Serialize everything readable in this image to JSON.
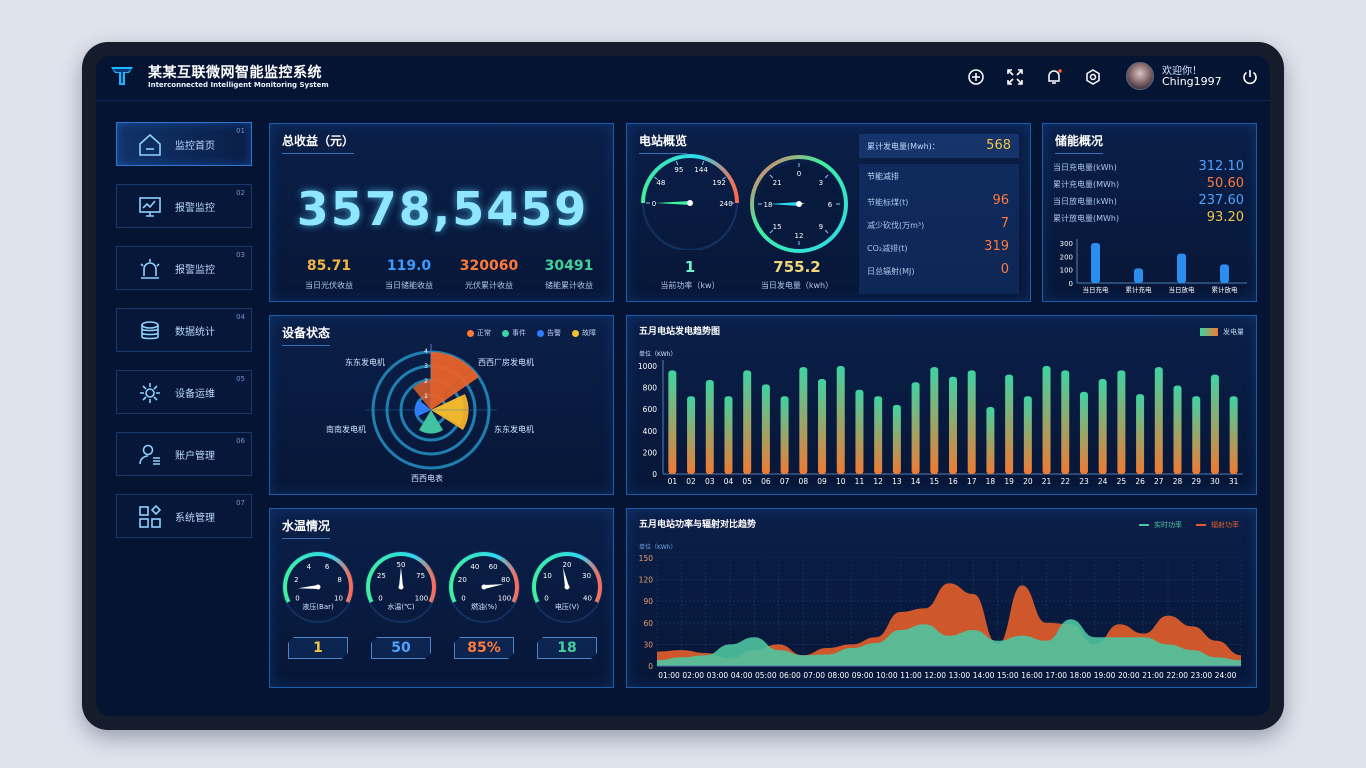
{
  "app": {
    "title": "某某互联微网智能监控系统",
    "subtitle": "Interconnected Intelligent Monitoring System",
    "welcome": "欢迎你！",
    "username": "Ching1997"
  },
  "header_icons": [
    "add-circle-icon",
    "fullscreen-icon",
    "bell-icon",
    "settings-icon",
    "power-icon"
  ],
  "nav": [
    {
      "label": "监控首页",
      "num": "01",
      "icon": "home-icon",
      "active": true
    },
    {
      "label": "报警监控",
      "num": "02",
      "icon": "monitor-chart-icon"
    },
    {
      "label": "报警监控",
      "num": "03",
      "icon": "alarm-light-icon"
    },
    {
      "label": "数据统计",
      "num": "04",
      "icon": "database-icon"
    },
    {
      "label": "设备运维",
      "num": "05",
      "icon": "gear-icon"
    },
    {
      "label": "账户管理",
      "num": "06",
      "icon": "user-icon"
    },
    {
      "label": "系统管理",
      "num": "07",
      "icon": "apps-icon"
    }
  ],
  "revenue": {
    "title": "总收益（元）",
    "total": "3578,5459",
    "stats": [
      {
        "value": "85.71",
        "label": "当日光伏收益",
        "color": "#f2b642"
      },
      {
        "value": "119.0",
        "label": "当日储能收益",
        "color": "#3d9bff"
      },
      {
        "value": "320060",
        "label": "光伏累计收益",
        "color": "#ff7a3a"
      },
      {
        "value": "30491",
        "label": "储能累计收益",
        "color": "#41d19b"
      }
    ]
  },
  "station": {
    "title": "电站概览",
    "gauge1": {
      "ticks": [
        "0",
        "48",
        "95",
        "144",
        "192",
        "240"
      ],
      "value": "1",
      "label": "当前功率（kw）",
      "reading": 1
    },
    "gauge2": {
      "ticks": [
        "0",
        "3",
        "6",
        "9",
        "12",
        "15",
        "18",
        "21"
      ],
      "value": "755.2",
      "label": "当日发电量（kwh）"
    },
    "cum_label": "累计发电量(Mwh)：",
    "cum_value": "568",
    "save_title": "节能减排",
    "items": [
      {
        "label": "节能标煤(t)",
        "value": "96"
      },
      {
        "label": "减少砍伐(万m³)",
        "value": "7"
      },
      {
        "label": "CO₂减排(t)",
        "value": "319"
      },
      {
        "label": "日总辐射(MJ)",
        "value": "0"
      }
    ]
  },
  "storage": {
    "title": "储能概况",
    "items": [
      {
        "label": "当日充电量(kWh)",
        "value": "312.10",
        "color": "#4fa3ff"
      },
      {
        "label": "累计充电量(MWh)",
        "value": "50.60",
        "color": "#ff7a3a"
      },
      {
        "label": "当日放电量(kWh)",
        "value": "237.60",
        "color": "#4fa3ff"
      },
      {
        "label": "累计放电量(MWh)",
        "value": "93.20",
        "color": "#f2c542"
      }
    ]
  },
  "storage_chart": {
    "type": "bar",
    "categories": [
      "当日充电",
      "累计充电",
      "当日放电",
      "累计放电"
    ],
    "values": [
      300,
      110,
      220,
      140
    ],
    "yticks": [
      "0",
      "100",
      "200",
      "300"
    ],
    "ylim": [
      0,
      300
    ]
  },
  "device": {
    "title": "设备状态",
    "legend": [
      {
        "name": "正常",
        "color": "#ff7a2f"
      },
      {
        "name": "事件",
        "color": "#3fd3a3"
      },
      {
        "name": "告警",
        "color": "#2f7cff"
      },
      {
        "name": "故障",
        "color": "#f2c130"
      }
    ],
    "labels": [
      "东东发电机",
      "西西厂房发电机",
      "东东发电机",
      "西西电表",
      "南南发电机"
    ],
    "rticks": [
      "1",
      "2",
      "3",
      "4"
    ]
  },
  "water": {
    "title": "水温情况",
    "gauges": [
      {
        "label": "液压(Bar)",
        "ticks": [
          "0",
          "2",
          "4",
          "6",
          "8",
          "10"
        ],
        "value": "1",
        "color": "#f2c542"
      },
      {
        "label": "水温(℃)",
        "ticks": [
          "0",
          "25",
          "50",
          "75",
          "100"
        ],
        "value": "50",
        "color": "#4fa3ff"
      },
      {
        "label": "燃油(%)",
        "ticks": [
          "0",
          "20",
          "40",
          "60",
          "80",
          "100"
        ],
        "value": "85%",
        "color": "#ff7a3a"
      },
      {
        "label": "电压(V)",
        "ticks": [
          "0",
          "10",
          "20",
          "30",
          "40"
        ],
        "value": "18",
        "color": "#41d19b"
      }
    ]
  },
  "chart_data": [
    {
      "type": "bar",
      "title": "五月电站发电趋势图",
      "ylabel": "单位（KWh）",
      "legend": "发电量",
      "categories": [
        "01",
        "02",
        "03",
        "04",
        "05",
        "06",
        "07",
        "08",
        "09",
        "10",
        "11",
        "12",
        "13",
        "14",
        "15",
        "16",
        "17",
        "18",
        "19",
        "20",
        "21",
        "22",
        "23",
        "24",
        "25",
        "26",
        "27",
        "28",
        "29",
        "30",
        "31"
      ],
      "values": [
        960,
        720,
        870,
        720,
        960,
        830,
        720,
        990,
        880,
        1000,
        780,
        720,
        640,
        850,
        990,
        900,
        960,
        620,
        920,
        720,
        1000,
        960,
        760,
        880,
        960,
        740,
        990,
        820,
        720,
        920,
        720
      ],
      "yticks": [
        "0",
        "200",
        "400",
        "600",
        "800",
        "1000"
      ],
      "ylim": [
        0,
        1000
      ]
    },
    {
      "type": "area",
      "title": "五月电站功率与辐射对比趋势",
      "ylabel": "单位（KWh）",
      "series": [
        {
          "name": "实时功率",
          "color": "#4fc4a0",
          "values": [
            8,
            12,
            15,
            30,
            40,
            22,
            15,
            16,
            25,
            32,
            50,
            58,
            42,
            50,
            35,
            42,
            35,
            65,
            40,
            40,
            40,
            30,
            22,
            12,
            8
          ]
        },
        {
          "name": "辐射功率",
          "color": "#e05d2a",
          "values": [
            20,
            22,
            18,
            10,
            22,
            30,
            15,
            25,
            30,
            40,
            75,
            80,
            115,
            100,
            30,
            112,
            60,
            58,
            30,
            58,
            45,
            70,
            55,
            35,
            15
          ]
        }
      ],
      "categories": [
        "01:00",
        "02:00",
        "03:00",
        "04:00",
        "05:00",
        "06:00",
        "07:00",
        "08:00",
        "09:00",
        "10:00",
        "11:00",
        "12:00",
        "13:00",
        "14:00",
        "15:00",
        "16:00",
        "17:00",
        "18:00",
        "19:00",
        "20:00",
        "21:00",
        "22:00",
        "23:00",
        "24:00"
      ],
      "yticks": [
        "0",
        "30",
        "60",
        "90",
        "120",
        "150"
      ],
      "ylim": [
        0,
        150
      ]
    }
  ]
}
